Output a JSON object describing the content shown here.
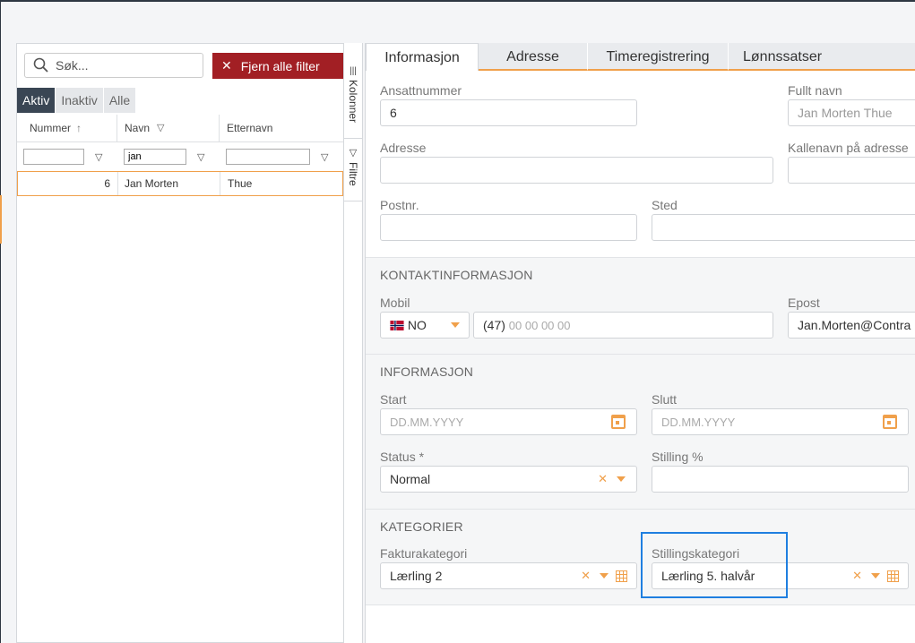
{
  "left": {
    "search_placeholder": "Søk...",
    "clear_filter_label": "Fjern alle filter",
    "segments": [
      "Aktiv",
      "Inaktiv",
      "Alle"
    ],
    "columns": [
      "Nummer",
      "Navn",
      "Etternavn"
    ],
    "sort_indicator": "↑",
    "filter_values": [
      "",
      "jan",
      ""
    ],
    "rows": [
      {
        "nummer": "6",
        "navn": "Jan Morten",
        "etternavn": "Thue"
      }
    ]
  },
  "side_tabs": {
    "columns": "Kolonner",
    "filters": "Filtre"
  },
  "tabs": [
    "Informasjon",
    "Adresse",
    "Timeregistrering",
    "Lønnssatser"
  ],
  "form": {
    "ansattnummer": {
      "label": "Ansattnummer",
      "value": "6"
    },
    "fullt_navn": {
      "label": "Fullt navn",
      "value": "Jan Morten Thue"
    },
    "adresse": {
      "label": "Adresse",
      "value": ""
    },
    "kallenavn": {
      "label": "Kallenavn på adresse",
      "value": ""
    },
    "postnr": {
      "label": "Postnr.",
      "value": ""
    },
    "sted": {
      "label": "Sted",
      "value": ""
    },
    "kontakt_title": "KONTAKTINFORMASJON",
    "mobil": {
      "label": "Mobil",
      "country": "NO",
      "prefix": "(47)",
      "placeholder": "00 00 00 00"
    },
    "epost": {
      "label": "Epost",
      "value": "Jan.Morten@Contra"
    },
    "info_title": "INFORMASJON",
    "start": {
      "label": "Start",
      "placeholder": "DD.MM.YYYY"
    },
    "slutt": {
      "label": "Slutt",
      "placeholder": "DD.MM.YYYY"
    },
    "status": {
      "label": "Status *",
      "value": "Normal"
    },
    "stilling": {
      "label": "Stilling %",
      "value": ""
    },
    "kategori_title": "KATEGORIER",
    "fakturakategori": {
      "label": "Fakturakategori",
      "value": "Lærling 2"
    },
    "stillingskategori": {
      "label": "Stillingskategori",
      "value": "Lærling 5. halvår"
    }
  },
  "colors": {
    "accent": "#f0a04b",
    "danger": "#a21f24",
    "dark": "#3a4654",
    "highlight": "#1f7fe0"
  }
}
